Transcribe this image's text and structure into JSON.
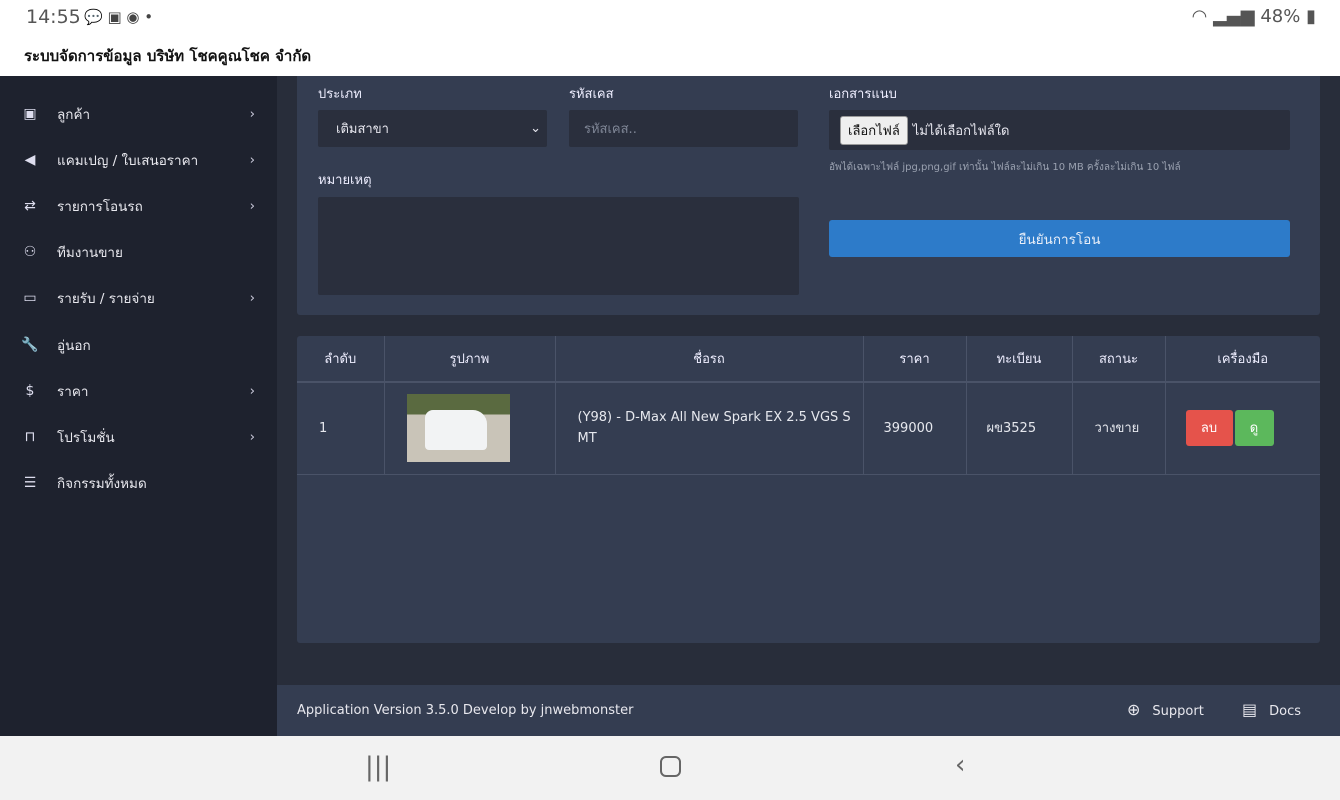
{
  "status": {
    "time": "14:55",
    "notif_icons": [
      "line-icon",
      "facebook-icon",
      "messenger-icon"
    ],
    "battery": "48%"
  },
  "app": {
    "title": "ระบบจัดการข้อมูล บริษัท โชคคูณโชค จำกัด"
  },
  "sidebar": {
    "items": [
      {
        "label": "ลูกค้า",
        "icon": "contact-icon",
        "chevron": true
      },
      {
        "label": "แคมเปญ / ใบเสนอราคา",
        "icon": "megaphone-icon",
        "chevron": true
      },
      {
        "label": "รายการโอนรถ",
        "icon": "transfer-icon",
        "chevron": true
      },
      {
        "label": "ทีมงานขาย",
        "icon": "team-icon",
        "chevron": false
      },
      {
        "label": "รายรับ / รายจ่าย",
        "icon": "credit-card-icon",
        "chevron": true
      },
      {
        "label": "อู่นอก",
        "icon": "wrench-icon",
        "chevron": false
      },
      {
        "label": "ราคา",
        "icon": "dollar-icon",
        "chevron": true
      },
      {
        "label": "โปรโมชั่น",
        "icon": "bookmark-icon",
        "chevron": true
      },
      {
        "label": "กิจกรรมทั้งหมด",
        "icon": "list-icon",
        "chevron": false
      }
    ]
  },
  "form": {
    "type_label": "ประเภท",
    "type_value": "เติมสาขา",
    "case_label": "รหัสเคส",
    "case_placeholder": "รหัสเคส..",
    "attach_label": "เอกสารแนบ",
    "file_button": "เลือกไฟล์",
    "file_status": "ไม่ได้เลือกไฟล์ใด",
    "attach_hint": "อัพได้เฉพาะไฟล์ jpg,png,gif เท่านั้น ไฟล์ละไม่เกิน 10 MB ครั้งละไม่เกิน 10 ไฟล์",
    "note_label": "หมายเหตุ",
    "note_value": "",
    "submit": "ยืนยันการโอน"
  },
  "table": {
    "headers": [
      "ลำดับ",
      "รูปภาพ",
      "ชื่อรถ",
      "ราคา",
      "ทะเบียน",
      "สถานะ",
      "เครื่องมือ"
    ],
    "rows": [
      {
        "no": "1",
        "name": "(Y98) - D-Max All New Spark EX 2.5 VGS S MT",
        "price": "399000",
        "plate": "ผข3525",
        "status": "วางขาย",
        "delete": "ลบ",
        "view": "ดู"
      }
    ]
  },
  "footer": {
    "version": "Application Version 3.5.0 Develop by jnwebmonster",
    "support": "Support",
    "docs": "Docs"
  },
  "colors": {
    "accent": "#2d7bc9",
    "danger": "#e5534b",
    "success": "#5cb85c"
  }
}
